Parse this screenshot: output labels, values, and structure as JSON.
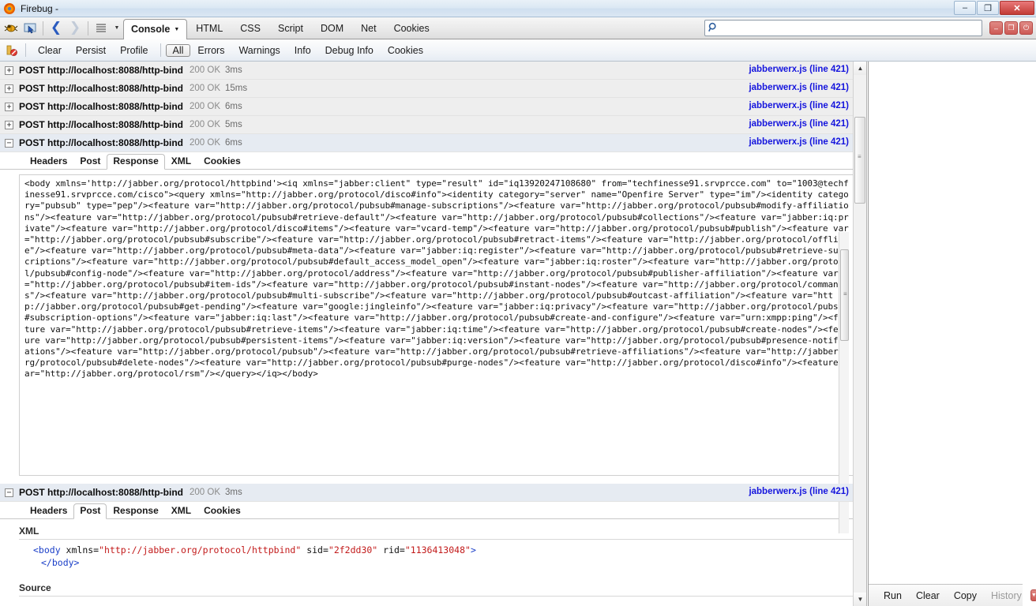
{
  "window": {
    "title": "Firebug -",
    "logo_icon": "firefox-icon",
    "minimize_label": "–",
    "maximize_label": "❐",
    "close_label": "✕"
  },
  "toolbar": {
    "icons": [
      {
        "name": "firebug-bug-icon",
        "glyph": "🐞"
      },
      {
        "name": "inspect-element-icon",
        "glyph": "⬚"
      },
      {
        "name": "back-arrow-icon",
        "glyph": "❮"
      },
      {
        "name": "forward-arrow-icon",
        "glyph": "❯"
      },
      {
        "name": "menu-lines-icon",
        "glyph": "≡"
      },
      {
        "name": "toolbar-dropdown-icon",
        "glyph": "▼"
      }
    ],
    "panel_tabs": [
      {
        "label": "Console",
        "active": true,
        "has_caret": true
      },
      {
        "label": "HTML",
        "active": false,
        "has_caret": false
      },
      {
        "label": "CSS",
        "active": false,
        "has_caret": false
      },
      {
        "label": "Script",
        "active": false,
        "has_caret": false
      },
      {
        "label": "DOM",
        "active": false,
        "has_caret": false
      },
      {
        "label": "Net",
        "active": false,
        "has_caret": false
      },
      {
        "label": "Cookies",
        "active": false,
        "has_caret": false
      }
    ],
    "search": {
      "value": "",
      "placeholder": "",
      "icon": "search-icon"
    },
    "mini_buttons": [
      {
        "name": "mini-minimize-button",
        "glyph": "–"
      },
      {
        "name": "mini-restore-button",
        "glyph": "❐"
      },
      {
        "name": "mini-close-button",
        "glyph": "⏻"
      }
    ]
  },
  "console_toolbar": {
    "clear_console_icon": "clear-console-icon",
    "items": [
      {
        "label": "Clear",
        "active": false
      },
      {
        "label": "Persist",
        "active": false
      },
      {
        "label": "Profile",
        "active": false
      },
      {
        "label": "All",
        "active": true
      },
      {
        "label": "Errors",
        "active": false
      },
      {
        "label": "Warnings",
        "active": false
      },
      {
        "label": "Info",
        "active": false
      },
      {
        "label": "Debug Info",
        "active": false
      },
      {
        "label": "Cookies",
        "active": false
      }
    ]
  },
  "console": {
    "requests": [
      {
        "twisty": "+",
        "method_url": "POST http://localhost:8088/http-bind",
        "status": "200 OK",
        "time": "3ms",
        "source": "jabberwerx.js (line 421)"
      },
      {
        "twisty": "+",
        "method_url": "POST http://localhost:8088/http-bind",
        "status": "200 OK",
        "time": "15ms",
        "source": "jabberwerx.js (line 421)"
      },
      {
        "twisty": "+",
        "method_url": "POST http://localhost:8088/http-bind",
        "status": "200 OK",
        "time": "6ms",
        "source": "jabberwerx.js (line 421)"
      },
      {
        "twisty": "+",
        "method_url": "POST http://localhost:8088/http-bind",
        "status": "200 OK",
        "time": "5ms",
        "source": "jabberwerx.js (line 421)"
      },
      {
        "twisty": "−",
        "method_url": "POST http://localhost:8088/http-bind",
        "status": "200 OK",
        "time": "6ms",
        "source": "jabberwerx.js (line 421)"
      }
    ],
    "expanded_request": {
      "tabs": [
        {
          "label": "Headers",
          "active": false
        },
        {
          "label": "Post",
          "active": false
        },
        {
          "label": "Response",
          "active": true
        },
        {
          "label": "XML",
          "active": false
        },
        {
          "label": "Cookies",
          "active": false
        }
      ],
      "response_body": "<body xmlns='http://jabber.org/protocol/httpbind'><iq xmlns=\"jabber:client\" type=\"result\" id=\"iq13920247108680\" from=\"techfinesse91.srvprcce.com\" to=\"1003@techfinesse91.srvprcce.com/cisco\"><query xmlns=\"http://jabber.org/protocol/disco#info\"><identity category=\"server\" name=\"Openfire Server\" type=\"im\"/><identity category=\"pubsub\" type=\"pep\"/><feature var=\"http://jabber.org/protocol/pubsub#manage-subscriptions\"/><feature var=\"http://jabber.org/protocol/pubsub#modify-affiliations\"/><feature var=\"http://jabber.org/protocol/pubsub#retrieve-default\"/><feature var=\"http://jabber.org/protocol/pubsub#collections\"/><feature var=\"jabber:iq:private\"/><feature var=\"http://jabber.org/protocol/disco#items\"/><feature var=\"vcard-temp\"/><feature var=\"http://jabber.org/protocol/pubsub#publish\"/><feature var=\"http://jabber.org/protocol/pubsub#subscribe\"/><feature var=\"http://jabber.org/protocol/pubsub#retract-items\"/><feature var=\"http://jabber.org/protocol/offline\"/><feature var=\"http://jabber.org/protocol/pubsub#meta-data\"/><feature var=\"jabber:iq:register\"/><feature var=\"http://jabber.org/protocol/pubsub#retrieve-subscriptions\"/><feature var=\"http://jabber.org/protocol/pubsub#default_access_model_open\"/><feature var=\"jabber:iq:roster\"/><feature var=\"http://jabber.org/protocol/pubsub#config-node\"/><feature var=\"http://jabber.org/protocol/address\"/><feature var=\"http://jabber.org/protocol/pubsub#publisher-affiliation\"/><feature var=\"http://jabber.org/protocol/pubsub#item-ids\"/><feature var=\"http://jabber.org/protocol/pubsub#instant-nodes\"/><feature var=\"http://jabber.org/protocol/commands\"/><feature var=\"http://jabber.org/protocol/pubsub#multi-subscribe\"/><feature var=\"http://jabber.org/protocol/pubsub#outcast-affiliation\"/><feature var=\"http://jabber.org/protocol/pubsub#get-pending\"/><feature var=\"google:jingleinfo\"/><feature var=\"jabber:iq:privacy\"/><feature var=\"http://jabber.org/protocol/pubsub#subscription-options\"/><feature var=\"jabber:iq:last\"/><feature var=\"http://jabber.org/protocol/pubsub#create-and-configure\"/><feature var=\"urn:xmpp:ping\"/><feature var=\"http://jabber.org/protocol/pubsub#retrieve-items\"/><feature var=\"jabber:iq:time\"/><feature var=\"http://jabber.org/protocol/pubsub#create-nodes\"/><feature var=\"http://jabber.org/protocol/pubsub#persistent-items\"/><feature var=\"jabber:iq:version\"/><feature var=\"http://jabber.org/protocol/pubsub#presence-notifications\"/><feature var=\"http://jabber.org/protocol/pubsub\"/><feature var=\"http://jabber.org/protocol/pubsub#retrieve-affiliations\"/><feature var=\"http://jabber.org/protocol/pubsub#delete-nodes\"/><feature var=\"http://jabber.org/protocol/pubsub#purge-nodes\"/><feature var=\"http://jabber.org/protocol/disco#info\"/><feature var=\"http://jabber.org/protocol/rsm\"/></query></iq></body>"
    },
    "post_request": {
      "twisty": "−",
      "method_url": "POST http://localhost:8088/http-bind",
      "status": "200 OK",
      "time": "3ms",
      "source": "jabberwerx.js (line 421)",
      "tabs": [
        {
          "label": "Headers",
          "active": false
        },
        {
          "label": "Post",
          "active": true
        },
        {
          "label": "Response",
          "active": false
        },
        {
          "label": "XML",
          "active": false
        },
        {
          "label": "Cookies",
          "active": false
        }
      ],
      "xml_label": "XML",
      "xml_open_tag": "<body",
      "xml_attr1_name": " xmlns=",
      "xml_attr1_value": "\"http://jabber.org/protocol/httpbind\"",
      "xml_attr2_name": " sid=",
      "xml_attr2_value": "\"2f2dd30\"",
      "xml_attr3_name": " rid=",
      "xml_attr3_value": "\"1136413048\"",
      "xml_open_close": ">",
      "xml_close_tag": "</body>",
      "source_label": "Source"
    }
  },
  "command_editor": {
    "value": "",
    "placeholder": "",
    "buttons": [
      {
        "label": "Run",
        "dim": false
      },
      {
        "label": "Clear",
        "dim": false
      },
      {
        "label": "Copy",
        "dim": false
      },
      {
        "label": "History",
        "dim": true
      }
    ],
    "dropdown_icon": "history-dropdown-icon",
    "dropdown_glyph": "▼"
  },
  "scrollbars": {
    "up_arrow": "▲",
    "down_arrow": "▼",
    "grip": "≡"
  },
  "colors": {
    "source_link": "#1515dd",
    "attr_value": "#c21a1a",
    "tag": "#1a3ec8",
    "row_bg": "#eeeeee"
  }
}
